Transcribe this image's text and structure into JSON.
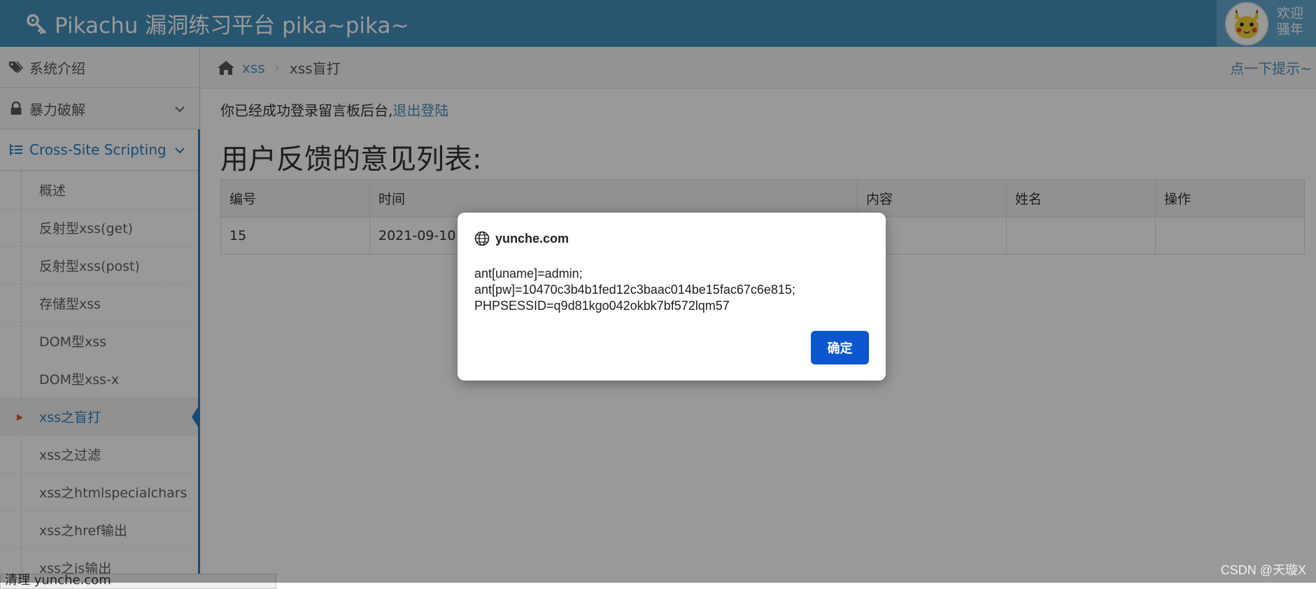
{
  "navbar": {
    "brand": "Pikachu 漏洞练习平台 pika~pika~",
    "welcome_line1": "欢迎",
    "welcome_line2": "骚年"
  },
  "sidebar": {
    "sections": [
      {
        "label": "系统介绍",
        "icon": "tags-icon"
      },
      {
        "label": "暴力破解",
        "icon": "lock-icon"
      },
      {
        "label": "Cross-Site Scripting",
        "icon": "list-icon"
      }
    ],
    "items": [
      {
        "label": "概述"
      },
      {
        "label": "反射型xss(get)"
      },
      {
        "label": "反射型xss(post)"
      },
      {
        "label": "存储型xss"
      },
      {
        "label": "DOM型xss"
      },
      {
        "label": "DOM型xss-x"
      },
      {
        "label": "xss之盲打"
      },
      {
        "label": "xss之过滤"
      },
      {
        "label": "xss之htmlspecialchars"
      },
      {
        "label": "xss之href输出"
      },
      {
        "label": "xss之js输出"
      }
    ]
  },
  "breadcrumb": {
    "parent": "xss",
    "current": "xss盲打",
    "hint": "点一下提示~"
  },
  "content": {
    "login_message": "你已经成功登录留言板后台,",
    "logout_link": "退出登陆",
    "list_title": "用户反馈的意见列表:",
    "table": {
      "headers": [
        "编号",
        "时间",
        "内容",
        "姓名",
        "操作"
      ],
      "rows": [
        {
          "id": "15",
          "time": "2021-09-10 0",
          "content": "",
          "name": "",
          "action": ""
        }
      ]
    }
  },
  "status_bar": {
    "text": "清理 yunche.com"
  },
  "dialog": {
    "origin": "yunche.com",
    "line1": "ant[uname]=admin;",
    "line2": "ant[pw]=10470c3b4b1fed12c3baac014be15fac67c6e815;",
    "line3": "PHPSESSID=q9d81kgo042okbk7bf572lqm57",
    "ok_label": "确定"
  },
  "watermark": "CSDN @天璇X",
  "colors": {
    "navbar": "#438eb9",
    "accent": "#2b7dbc",
    "dialog_button": "#0b57d0"
  }
}
